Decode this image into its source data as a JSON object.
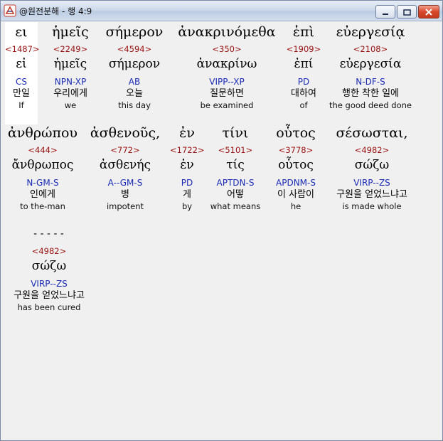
{
  "window": {
    "title": "@원전분해 - 행 4:9"
  },
  "rows": [
    {
      "words": [
        {
          "greek": "ει",
          "strong": "<1487>",
          "lemma": "εἰ",
          "morph": "CS",
          "korean": "만일",
          "english": "If",
          "selected": true
        },
        {
          "greek": "ἡμεῖς",
          "strong": "<2249>",
          "lemma": "ἡμεῖς",
          "morph": "NPN-XP",
          "korean": "우리에게",
          "english": "we"
        },
        {
          "greek": "σήμερον",
          "strong": "<4594>",
          "lemma": "σήμερον",
          "morph": "AB",
          "korean": "오늘",
          "english": "this day"
        },
        {
          "greek": "ἀνακρινόμεθα",
          "strong": "<350>",
          "lemma": "ἀνακρίνω",
          "morph": "VIPP--XP",
          "korean": "질문하면",
          "english": "be examined"
        },
        {
          "greek": "ἐπὶ",
          "strong": "<1909>",
          "lemma": "ἐπί",
          "morph": "PD",
          "korean": "대하여",
          "english": "of"
        },
        {
          "greek": "εὐεργεσίᾳ",
          "strong": "<2108>",
          "lemma": "εὐεργεσία",
          "morph": "N-DF-S",
          "korean": "행한 착한 일에",
          "english": "the good deed done"
        }
      ]
    },
    {
      "words": [
        {
          "greek": "ἀνθρώπου",
          "strong": "<444>",
          "lemma": "ἄνθρωπος",
          "morph": "N-GM-S",
          "korean": "인에게",
          "english": "to the-man"
        },
        {
          "greek": "ἀσθενοῦς,",
          "strong": "<772>",
          "lemma": "ἀσθενής",
          "morph": "A--GM-S",
          "korean": "병",
          "english": "impotent"
        },
        {
          "greek": "ἐν",
          "strong": "<1722>",
          "lemma": "ἐν",
          "morph": "PD",
          "korean": "게",
          "english": "by"
        },
        {
          "greek": "τίνι",
          "strong": "<5101>",
          "lemma": "τίς",
          "morph": "APTDN-S",
          "korean": "어떻",
          "english": "what means"
        },
        {
          "greek": "οὗτος",
          "strong": "<3778>",
          "lemma": "οὗτος",
          "morph": "APDNM-S",
          "korean": "이 사람이",
          "english": "he"
        },
        {
          "greek": "σέσωσται,",
          "strong": "<4982>",
          "lemma": "σώζω",
          "morph": "VIRP--ZS",
          "korean": "구원을 얻었느냐고",
          "english": "is made whole"
        }
      ]
    },
    {
      "words": [
        {
          "greek": "-----",
          "strong": "<4982>",
          "lemma": "σώζω",
          "morph": "VIRP--ZS",
          "korean": "구원을 얻었느냐고",
          "english": "has been cured"
        }
      ]
    }
  ]
}
